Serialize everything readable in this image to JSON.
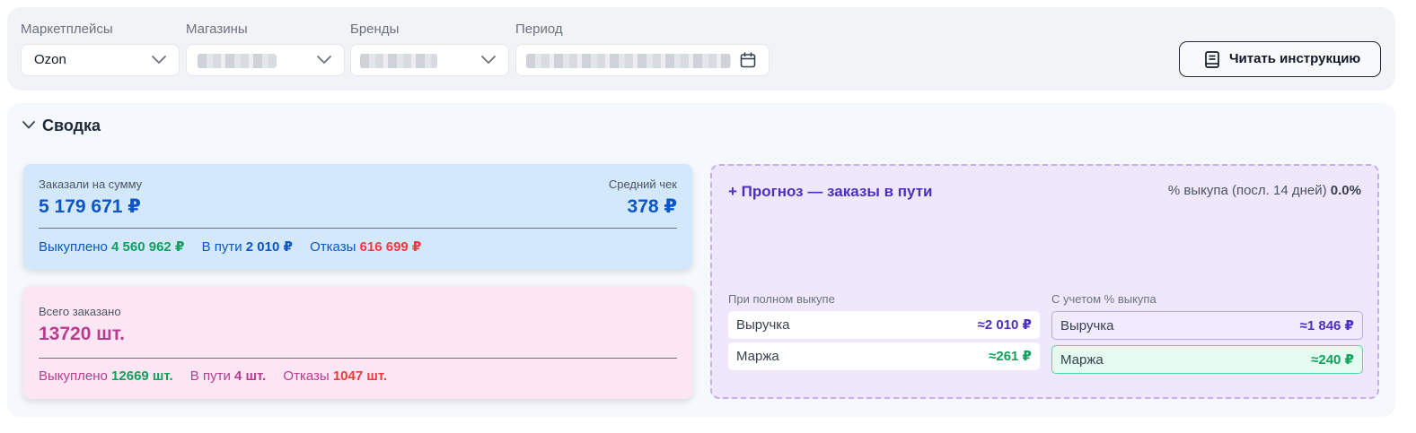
{
  "filters": {
    "marketplaces": {
      "label": "Маркетплейсы",
      "value": "Ozon"
    },
    "stores": {
      "label": "Магазины"
    },
    "brands": {
      "label": "Бренды"
    },
    "period": {
      "label": "Период"
    }
  },
  "instruction_button": {
    "label": "Читать инструкцию"
  },
  "summary": {
    "title": "Сводка",
    "ordered_sum": {
      "label": "Заказали на сумму",
      "value": "5 179 671 ₽",
      "avg_check_label": "Средний чек",
      "avg_check_value": "378 ₽",
      "bought_label": "Выкуплено",
      "bought_value": "4 560 962 ₽",
      "transit_label": "В пути",
      "transit_value": "2 010 ₽",
      "refusals_label": "Отказы",
      "refusals_value": "616 699 ₽"
    },
    "ordered_total": {
      "label": "Всего заказано",
      "value": "13720 шт.",
      "bought_label": "Выкуплено",
      "bought_value": "12669 шт.",
      "transit_label": "В пути",
      "transit_value": "4 шт.",
      "refusals_label": "Отказы",
      "refusals_value": "1047 шт."
    },
    "forecast": {
      "title": "+ Прогноз — заказы в пути",
      "pct_label": "% выкупа (посл. 14 дней)",
      "pct_value": "0.0%",
      "full": {
        "label": "При полном выкупе",
        "revenue_label": "Выручка",
        "revenue_value": "≈2 010 ₽",
        "margin_label": "Маржа",
        "margin_value": "≈261 ₽"
      },
      "adjusted": {
        "label": "С учетом % выкупа",
        "revenue_label": "Выручка",
        "revenue_value": "≈1 846 ₽",
        "margin_label": "Маржа",
        "margin_value": "≈240 ₽"
      }
    }
  },
  "colors": {
    "blue_text": "#0b55c9",
    "green": "#0da35c",
    "red": "#ef3b3b",
    "pink_text": "#b83d8f",
    "purple": "#4c2fc0"
  }
}
